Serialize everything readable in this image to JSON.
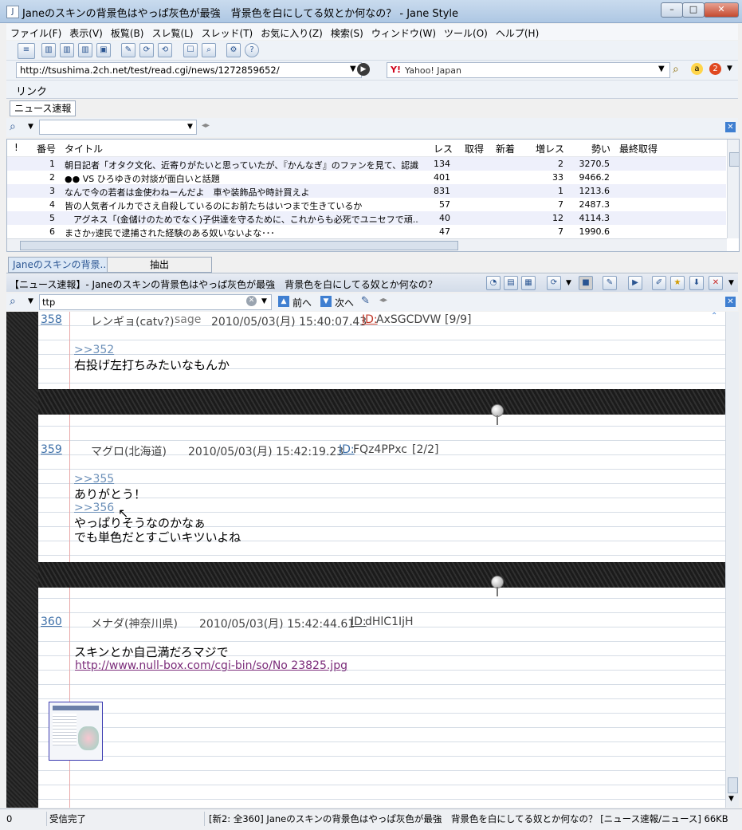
{
  "window": {
    "title": "Janeのスキンの背景色はやっぱ灰色が最強　背景色を白にしてる奴とか何なの？ - Jane Style",
    "app_icon": "J",
    "minimize": "–",
    "maximize": "□",
    "close": "✕"
  },
  "menu": [
    "ファイル(F)",
    "表示(V)",
    "板覧(B)",
    "スレ覧(L)",
    "スレッド(T)",
    "お気に入り(Z)",
    "検索(S)",
    "ウィンドウ(W)",
    "ツール(O)",
    "ヘルプ(H)"
  ],
  "address": {
    "url": "http://tsushima.2ch.net/test/read.cgi/news/1272859652/",
    "search_engine": "Yahoo!  Japan",
    "search_logo": "Y!"
  },
  "linkbar": {
    "label": "リンク"
  },
  "board_tab": "ニュース速報",
  "thread_list": {
    "headers": [
      "!",
      "番号",
      "タイトル",
      "レス",
      "取得",
      "新着",
      "増レス",
      "勢い",
      "最終取得"
    ],
    "rows": [
      {
        "no": "1",
        "title": "朝日記者「オタク文化、近寄りがたいと思っていたが、『かんなぎ』のファンを見て、認識...",
        "res": "134",
        "inc": "2",
        "momentum": "3270.5"
      },
      {
        "no": "2",
        "title": "●● VS ひろゆきの対談が面白いと話題",
        "res": "401",
        "inc": "33",
        "momentum": "9466.2"
      },
      {
        "no": "3",
        "title": "なんで今の若者は金使わねーんだよ　車や装飾品や時計買えよ",
        "res": "831",
        "inc": "1",
        "momentum": "1213.6"
      },
      {
        "no": "4",
        "title": "皆の人気者イルカでさえ自殺しているのにお前たちはいつまで生きているか",
        "res": "57",
        "inc": "7",
        "momentum": "2487.3"
      },
      {
        "no": "5",
        "title": "　アグネス「(金儲けのためでなく)子供達を守るために、これからも必死でユニセフで頑...",
        "res": "40",
        "inc": "12",
        "momentum": "4114.3"
      },
      {
        "no": "6",
        "title": "まさかｯ速民で逮捕された経験のある奴いないよな･･･",
        "res": "47",
        "inc": "7",
        "momentum": "1990.6"
      }
    ]
  },
  "thread_tabs": {
    "active": "Janeのスキンの背景...",
    "extract": "抽出"
  },
  "thread_title": "【ニュース速報】- Janeのスキンの背景色はやっぱ灰色が最強　背景色を白にしてる奴とか何なの？",
  "find": {
    "query": "ttp",
    "prev": "前へ",
    "next": "次へ"
  },
  "posts": [
    {
      "num": "358",
      "name": "レンギョ(catv?)",
      "mail": "sage",
      "date": "2010/05/03(月) 15:40:07.43",
      "id_label": "ID:",
      "id": "AxSGCDVW",
      "count": "[9/9]",
      "lines": [
        {
          "type": "anchor",
          "text": ">>352"
        },
        {
          "type": "text",
          "text": "右投げ左打ちみたいなもんか"
        }
      ]
    },
    {
      "num": "359",
      "name": "マグロ(北海道)",
      "mail": "",
      "date": "2010/05/03(月) 15:42:19.23",
      "id_label": "ID:",
      "id": "FQz4PPxc",
      "count": "[2/2]",
      "lines": [
        {
          "type": "anchor",
          "text": ">>355"
        },
        {
          "type": "text",
          "text": "ありがとう！"
        },
        {
          "type": "anchor",
          "text": ">>356"
        },
        {
          "type": "text",
          "text": "やっぱりそうなのかなぁ"
        },
        {
          "type": "text",
          "text": "でも単色だとすごいキツいよね"
        }
      ]
    },
    {
      "num": "360",
      "name": "メナダ(神奈川県)",
      "mail": "",
      "date": "2010/05/03(月) 15:42:44.61",
      "id_label": "ID:",
      "id": "dHlC1IjH",
      "count": "",
      "lines": [
        {
          "type": "text",
          "text": "スキンとか自己満だろマジで"
        },
        {
          "type": "link",
          "text": "http://www.null-box.com/cgi-bin/so/No 23825.jpg"
        }
      ]
    }
  ],
  "status": {
    "left": "0",
    "state": "受信完了",
    "info": "[新2: 全360]  Janeのスキンの背景色はやっぱ灰色が最強　背景色を白にしてる奴とか何なの？  [ニュース速報/ニュース]   66KB"
  },
  "colors": {
    "resnum": "#3d6fa8",
    "id_new": "#c0392b",
    "link": "#7b2c7a",
    "margin_line": "#e8a8a8"
  }
}
